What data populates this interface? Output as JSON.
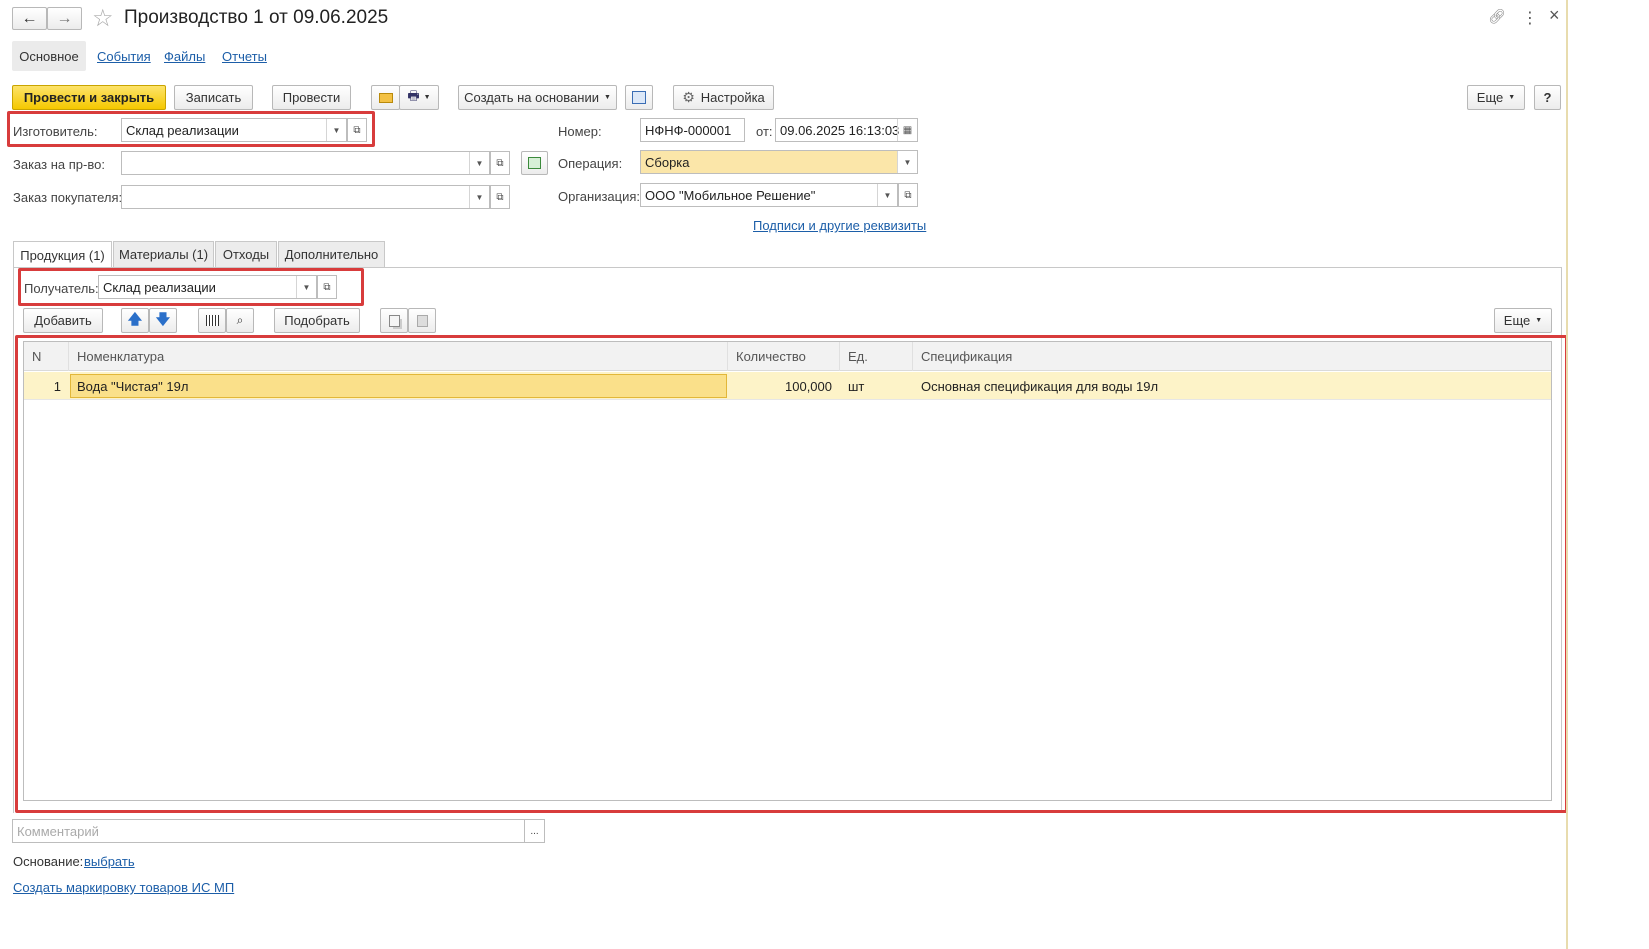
{
  "window": {
    "title": "Производство 1 от 09.06.2025",
    "nav_back": "←",
    "nav_forward": "→",
    "star": "☆",
    "link_icon": "🔗",
    "menu_icon": "⋮",
    "close_icon": "×"
  },
  "tabs_top": [
    "Основное",
    "События",
    "Файлы",
    "Отчеты"
  ],
  "toolbar": {
    "post_close": "Провести и закрыть",
    "save": "Записать",
    "post": "Провести",
    "create_based": "Создать на основании",
    "settings": "Настройка",
    "more": "Еще",
    "help": "?"
  },
  "form": {
    "manufacturer_label": "Изготовитель:",
    "manufacturer_value": "Склад реализации",
    "prod_order_label": "Заказ на пр-во:",
    "prod_order_value": "",
    "customer_order_label": "Заказ покупателя:",
    "customer_order_value": "",
    "number_label": "Номер:",
    "number_value": "НФНФ-000001",
    "date_label": "от:",
    "date_value": "09.06.2025 16:13:03",
    "operation_label": "Операция:",
    "operation_value": "Сборка",
    "org_label": "Организация:",
    "org_value": "ООО \"Мобильное Решение\"",
    "signatures_link": "Подписи и другие реквизиты"
  },
  "inner_tabs": [
    "Продукция (1)",
    "Материалы (1)",
    "Отходы",
    "Дополнительно"
  ],
  "products": {
    "recipient_label": "Получатель:",
    "recipient_value": "Склад реализации",
    "add_button": "Добавить",
    "pick_button": "Подобрать",
    "more_button": "Еще",
    "columns": [
      "N",
      "Номенклатура",
      "Количество",
      "Ед.",
      "Спецификация"
    ],
    "rows": [
      {
        "n": "1",
        "item": "Вода \"Чистая\" 19л",
        "qty": "100,000",
        "unit": "шт",
        "spec": "Основная спецификация для воды 19л"
      }
    ]
  },
  "footer": {
    "comment_placeholder": "Комментарий",
    "comment_btn": "...",
    "basis_label": "Основание:",
    "basis_link": "выбрать",
    "marking_link": "Создать маркировку товаров ИС МП"
  },
  "colors": {
    "accent_red": "#d83c3c",
    "primary_yellow": "#f5c800",
    "row_highlight": "#fdf3c8",
    "link_blue": "#1c5ea8"
  }
}
